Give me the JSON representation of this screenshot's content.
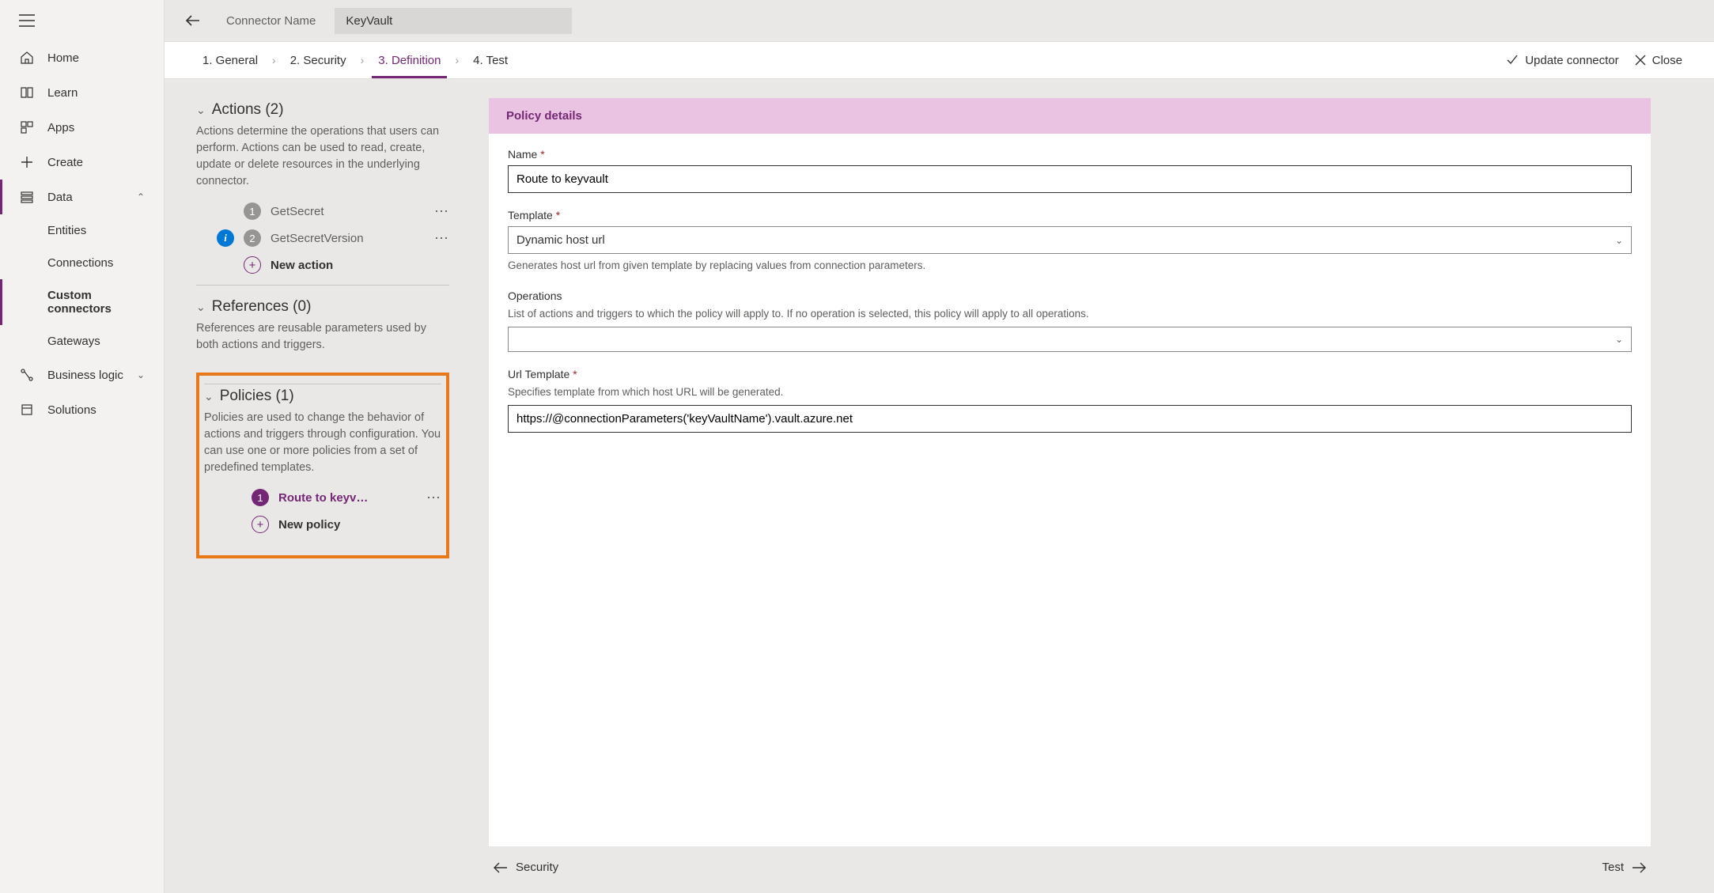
{
  "sidebar": {
    "home": "Home",
    "learn": "Learn",
    "apps": "Apps",
    "create": "Create",
    "data": "Data",
    "entities": "Entities",
    "connections": "Connections",
    "custom_connectors": "Custom connectors",
    "gateways": "Gateways",
    "business_logic": "Business logic",
    "solutions": "Solutions"
  },
  "header": {
    "connector_name_label": "Connector Name",
    "connector_name_value": "KeyVault"
  },
  "steps": {
    "s1": "1. General",
    "s2": "2. Security",
    "s3": "3. Definition",
    "s4": "4. Test",
    "update": "Update connector",
    "close": "Close"
  },
  "left": {
    "actions_title": "Actions (2)",
    "actions_desc": "Actions determine the operations that users can perform. Actions can be used to read, create, update or delete resources in the underlying connector.",
    "action1": "GetSecret",
    "action2": "GetSecretVersion",
    "new_action": "New action",
    "refs_title": "References (0)",
    "refs_desc": "References are reusable parameters used by both actions and triggers.",
    "policies_title": "Policies (1)",
    "policies_desc": "Policies are used to change the behavior of actions and triggers through configuration. You can use one or more policies from a set of predefined templates.",
    "policy1": "Route to keyv…",
    "new_policy": "New policy"
  },
  "details": {
    "panel_title": "Policy details",
    "name_label": "Name",
    "name_value": "Route to keyvault",
    "template_label": "Template",
    "template_value": "Dynamic host url",
    "template_help": "Generates host url from given template by replacing values from connection parameters.",
    "ops_label": "Operations",
    "ops_help": "List of actions and triggers to which the policy will apply to. If no operation is selected, this policy will apply to all operations.",
    "ops_value": "",
    "url_label": "Url Template",
    "url_help": "Specifies template from which host URL will be generated.",
    "url_value": "https://@connectionParameters('keyVaultName').vault.azure.net"
  },
  "footer": {
    "prev": "Security",
    "next": "Test"
  }
}
